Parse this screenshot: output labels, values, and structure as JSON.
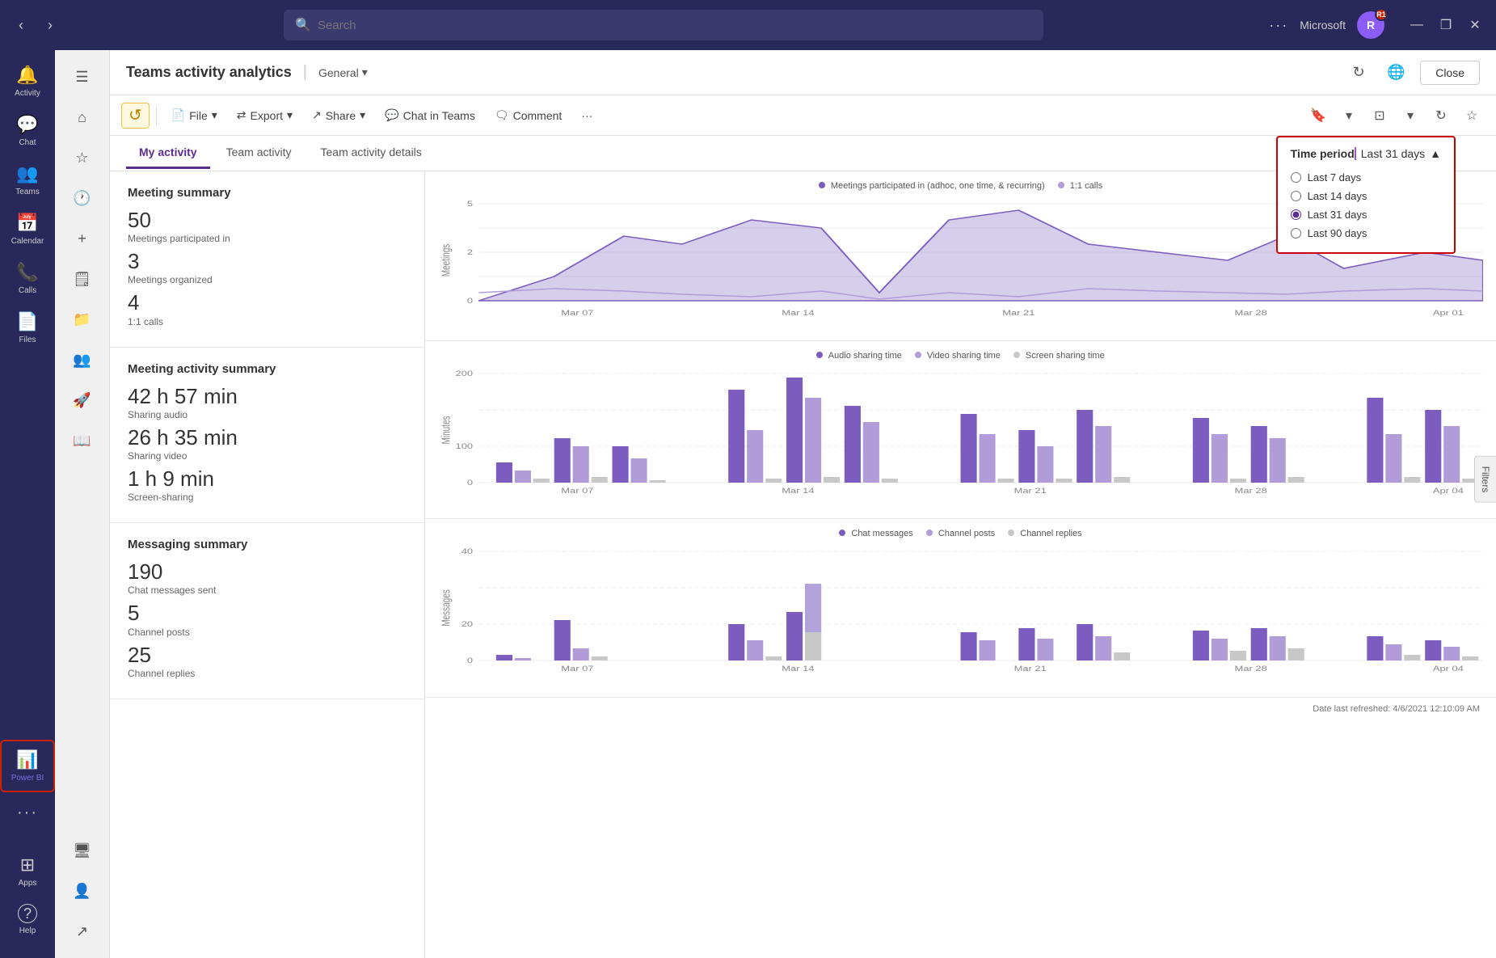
{
  "titlebar": {
    "search_placeholder": "Search",
    "user_label": "Microsoft",
    "avatar_initials": "R",
    "avatar_badge": "R1",
    "minimize": "—",
    "maximize": "❐",
    "close": "✕"
  },
  "nav": {
    "items": [
      {
        "label": "Activity",
        "icon": "🔔",
        "active": false
      },
      {
        "label": "Chat",
        "icon": "💬",
        "active": false
      },
      {
        "label": "Teams",
        "icon": "👥",
        "active": false
      },
      {
        "label": "Calendar",
        "icon": "📅",
        "active": false
      },
      {
        "label": "Calls",
        "icon": "📞",
        "active": false
      },
      {
        "label": "Files",
        "icon": "📄",
        "active": false
      },
      {
        "label": "Power BI",
        "icon": "📊",
        "active": true
      }
    ],
    "bottom_items": [
      {
        "label": "Apps",
        "icon": "⊞"
      },
      {
        "label": "Help",
        "icon": "?"
      }
    ]
  },
  "secondary_nav": {
    "items": [
      "≡",
      "⌂",
      "☆",
      "🕐",
      "✚",
      "🗒",
      "🗂",
      "👥",
      "🚀",
      "📖",
      "🖥",
      "👤"
    ]
  },
  "header": {
    "title": "Teams activity analytics",
    "separator": "|",
    "section": "General",
    "close_label": "Close"
  },
  "toolbar": {
    "file_label": "File",
    "export_label": "Export",
    "share_label": "Share",
    "chat_in_teams_label": "Chat in Teams",
    "comment_label": "Comment"
  },
  "tabs": {
    "items": [
      {
        "label": "My activity",
        "active": true
      },
      {
        "label": "Team activity",
        "active": false
      },
      {
        "label": "Team activity details",
        "active": false
      }
    ]
  },
  "time_period": {
    "label": "Time period",
    "current": "Last 31 days",
    "options": [
      "Last 7 days",
      "Last 14 days",
      "Last 31 days",
      "Last 90 days"
    ],
    "selected": "Last 31 days"
  },
  "meeting_summary": {
    "title": "Meeting summary",
    "meetings_participated": "50",
    "meetings_participated_label": "Meetings participated in",
    "meetings_organized": "3",
    "meetings_organized_label": "Meetings organized",
    "one_on_one_calls": "4",
    "one_on_one_calls_label": "1:1 calls"
  },
  "meeting_activity": {
    "title": "Meeting activity summary",
    "audio_time": "42 h 57 min",
    "audio_label": "Sharing audio",
    "video_time": "26 h 35 min",
    "video_label": "Sharing video",
    "screen_time": "1 h 9 min",
    "screen_label": "Screen-sharing"
  },
  "messaging": {
    "title": "Messaging summary",
    "chat_messages": "190",
    "chat_messages_label": "Chat messages sent",
    "channel_posts": "5",
    "channel_posts_label": "Channel posts",
    "channel_replies": "25",
    "channel_replies_label": "Channel replies"
  },
  "chart1": {
    "legend": [
      {
        "label": "Meetings participated in (adhoc, one time, & recurring)",
        "color": "#7c5cbf"
      },
      {
        "label": "1:1 calls",
        "color": "#b19cd9"
      }
    ],
    "y_label": "Meetings",
    "x_labels": [
      "Mar 07",
      "Mar 14",
      "Mar 21",
      "Mar 28",
      "Apr 01"
    ],
    "y_max": 5
  },
  "chart2": {
    "legend": [
      {
        "label": "Audio sharing time",
        "color": "#7c5cbf"
      },
      {
        "label": "Video sharing time",
        "color": "#b19cd9"
      },
      {
        "label": "Screen sharing time",
        "color": "#d3d3d3"
      }
    ],
    "y_label": "Minutes",
    "x_labels": [
      "Mar 07",
      "Mar 14",
      "Mar 21",
      "Mar 28",
      "Apr 04"
    ],
    "y_max": 200
  },
  "chart3": {
    "legend": [
      {
        "label": "Chat messages",
        "color": "#7c5cbf"
      },
      {
        "label": "Channel posts",
        "color": "#b19cd9"
      },
      {
        "label": "Channel replies",
        "color": "#d3d3d3"
      }
    ],
    "y_label": "Messages",
    "x_labels": [
      "Mar 07",
      "Mar 14",
      "Mar 21",
      "Mar 28",
      "Apr 04"
    ],
    "y_max": 40
  },
  "footer": {
    "date_label": "Date last refreshed: 4/6/2021 12:10:09 AM"
  },
  "filters": {
    "label": "Filters"
  }
}
